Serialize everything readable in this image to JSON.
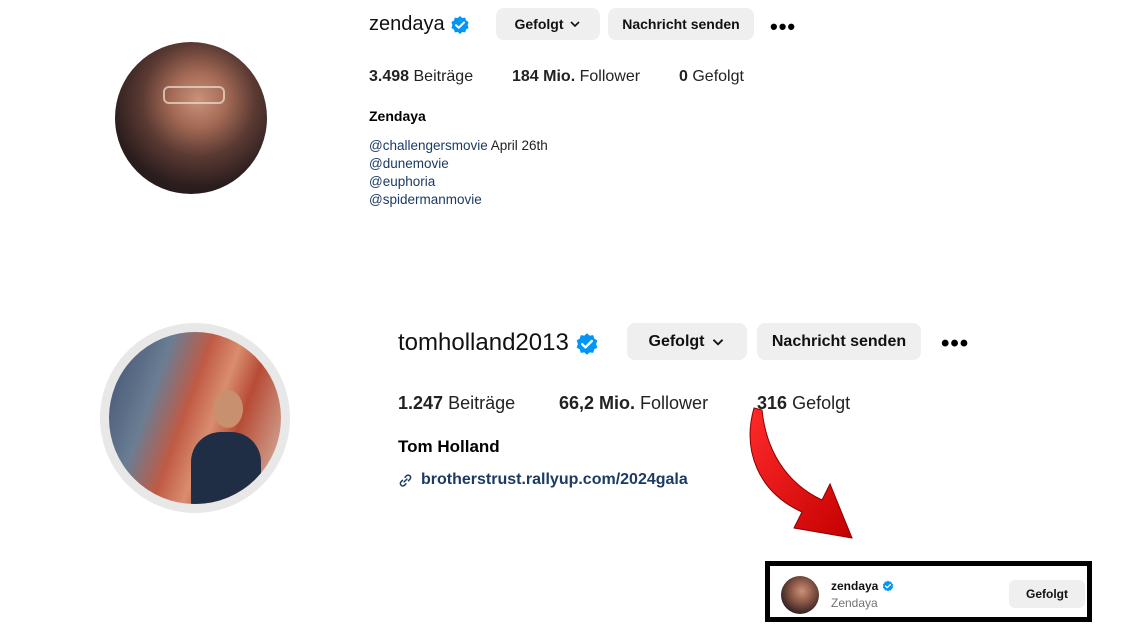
{
  "profile1": {
    "username": "zendaya",
    "follow_button": "Gefolgt",
    "message_button": "Nachricht senden",
    "more": "•••",
    "posts_count": "3.498",
    "posts_label": "Beiträge",
    "followers_count": "184 Mio.",
    "followers_label": "Follower",
    "following_count": "0",
    "following_label": "Gefolgt",
    "display_name": "Zendaya",
    "bio": {
      "line1_mention": "@challengersmovie",
      "line1_text": " April 26th",
      "line2": "@dunemovie",
      "line3": "@euphoria",
      "line4": "@spidermanmovie"
    }
  },
  "profile2": {
    "username": "tomholland2013",
    "follow_button": "Gefolgt",
    "message_button": "Nachricht senden",
    "more": "•••",
    "posts_count": "1.247",
    "posts_label": "Beiträge",
    "followers_count": "66,2 Mio.",
    "followers_label": "Follower",
    "following_count": "316",
    "following_label": "Gefolgt",
    "display_name": "Tom Holland",
    "link": "brotherstrust.rallyup.com/2024gala"
  },
  "following_entry": {
    "username": "zendaya",
    "display_name": "Zendaya",
    "button": "Gefolgt"
  },
  "colors": {
    "verified": "#0095f6",
    "button_bg": "#efefef",
    "link": "#1b3b65",
    "arrow": "#e01010"
  }
}
